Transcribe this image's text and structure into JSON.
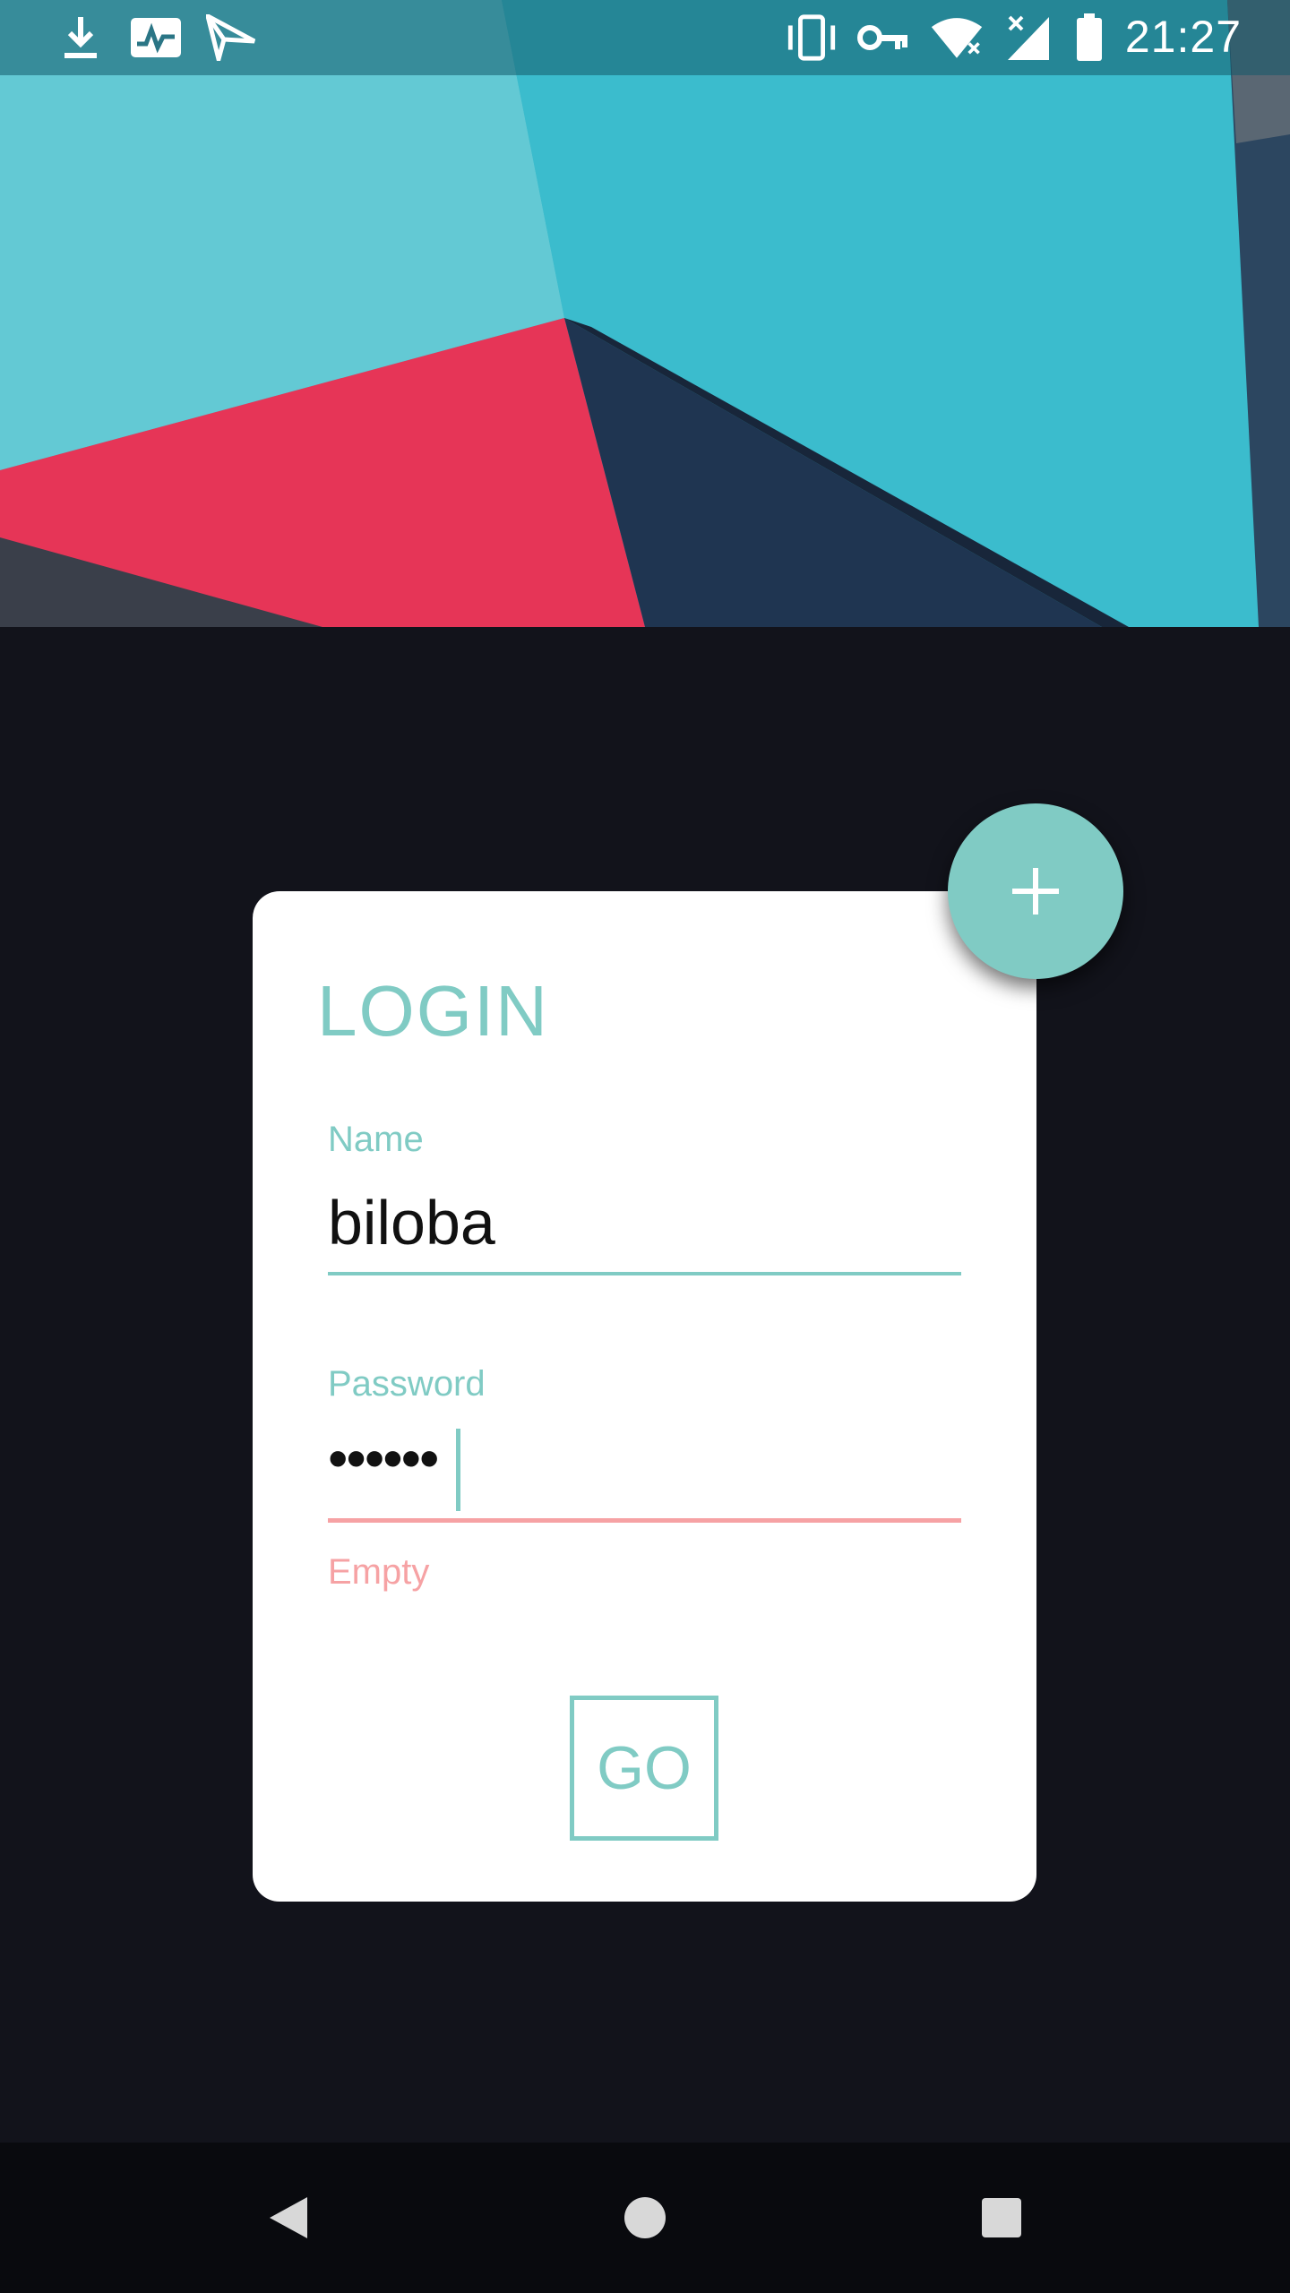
{
  "status_bar": {
    "time": "21:27",
    "left_icons": [
      "download-icon",
      "activity-image-icon",
      "send-icon"
    ],
    "right_icons": [
      "vibrate-icon",
      "vpn-key-icon",
      "wifi-off-icon",
      "signal-off-icon",
      "battery-icon"
    ]
  },
  "login": {
    "title": "LOGIN",
    "name_label": "Name",
    "name_value": "biloba",
    "password_label": "Password",
    "password_value": "••••••",
    "password_error": "Empty",
    "submit_label": "GO"
  },
  "fab": {
    "icon": "plus-icon"
  },
  "nav_bar": {
    "icons": [
      "back-icon",
      "home-icon",
      "recents-icon"
    ]
  },
  "colors": {
    "accent": "#80cbc4",
    "error": "#f6a2a4",
    "background": "#12131b",
    "card": "#ffffff"
  }
}
